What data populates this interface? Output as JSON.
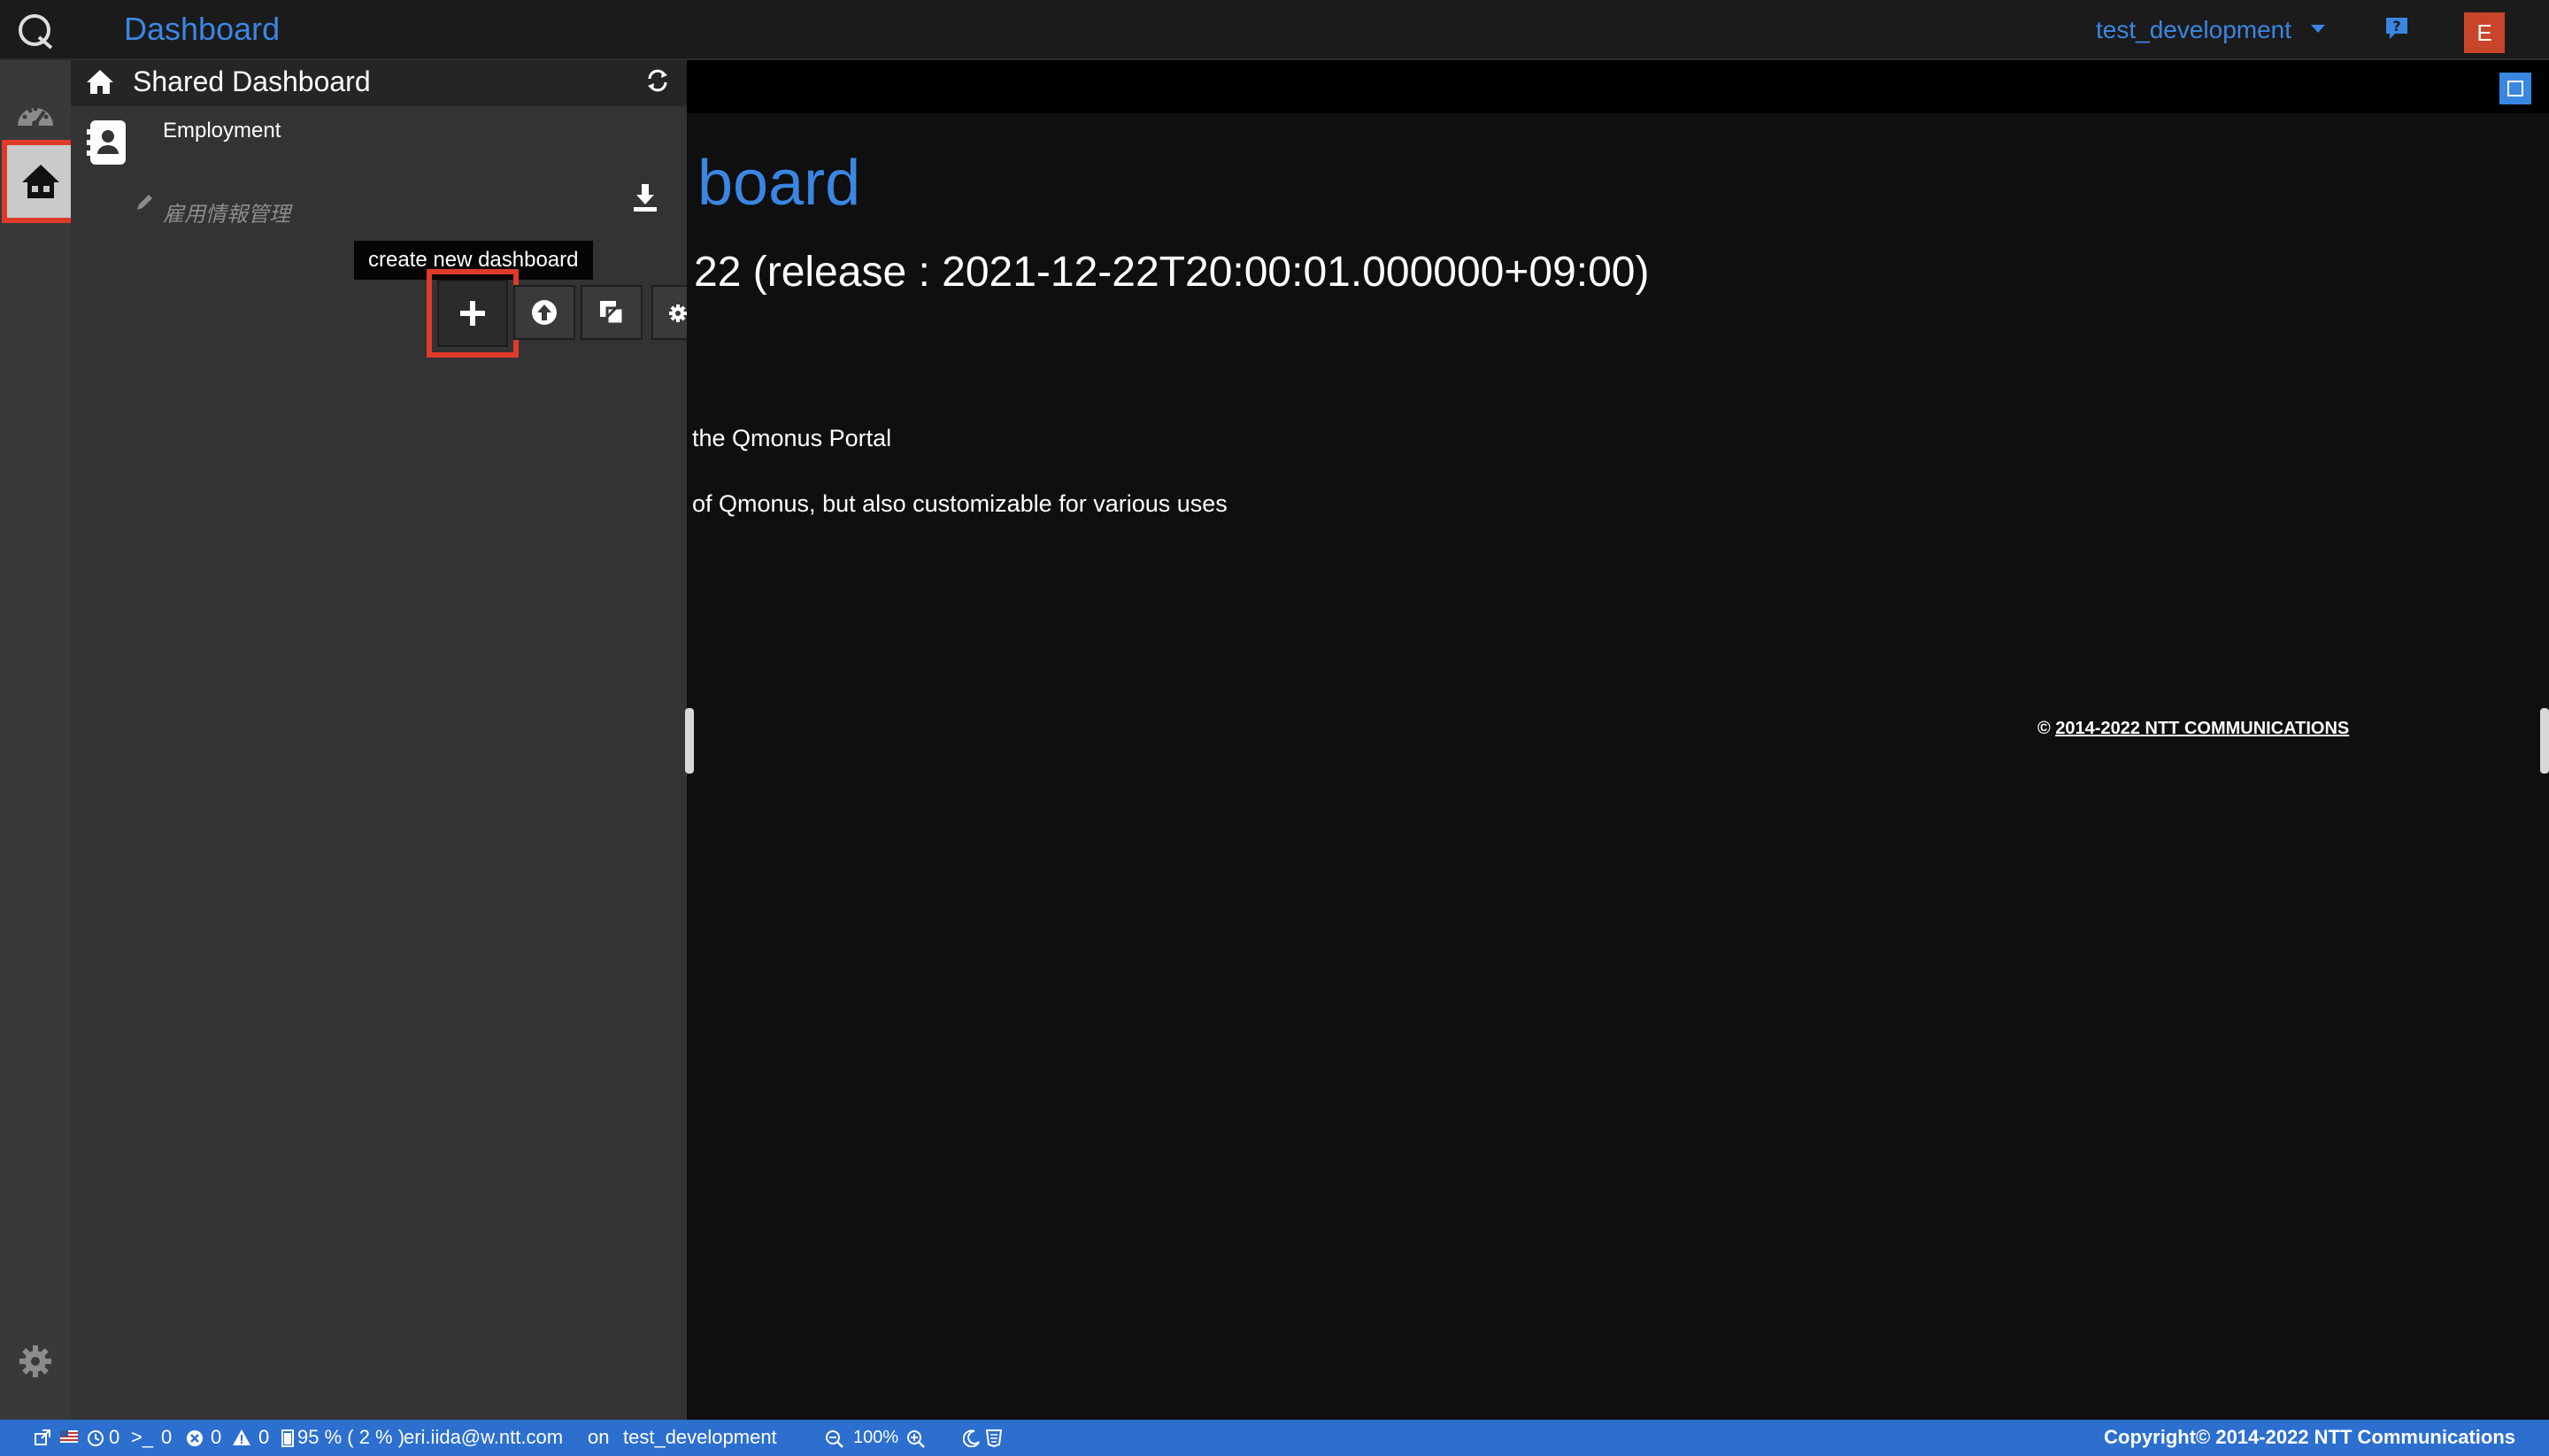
{
  "header": {
    "app_title": "Dashboard",
    "environment": "test_development",
    "avatar_initial": "E"
  },
  "panel": {
    "title": "Shared Dashboard",
    "items": [
      {
        "name": "Employment",
        "subtitle": "雇用情報管理"
      }
    ],
    "tooltip": "create new dashboard"
  },
  "main": {
    "heading": "board",
    "version_line": "22 (release : 2021-12-22T20:00:01.000000+09:00)",
    "line1": "the Qmonus Portal",
    "line2": "of Qmonus, but also customizable for various uses",
    "copyright_symbol": "©",
    "copyright_link": "2014-2022 NTT COMMUNICATIONS"
  },
  "statusbar": {
    "clock_count": "0",
    "terminal_count": "0",
    "error_count": "0",
    "warning_count": "0",
    "memory": "95 % ( 2 % )",
    "user_email": "eri.iida@w.ntt.com",
    "on_label": "on",
    "environment": "test_development",
    "zoom": "100%",
    "copyright": "Copyright© 2014-2022 NTT Communications"
  },
  "colors": {
    "accent": "#3a86e3",
    "highlight": "#e03a2a",
    "statusbar": "#2c6fcf",
    "avatar": "#c8452a"
  }
}
